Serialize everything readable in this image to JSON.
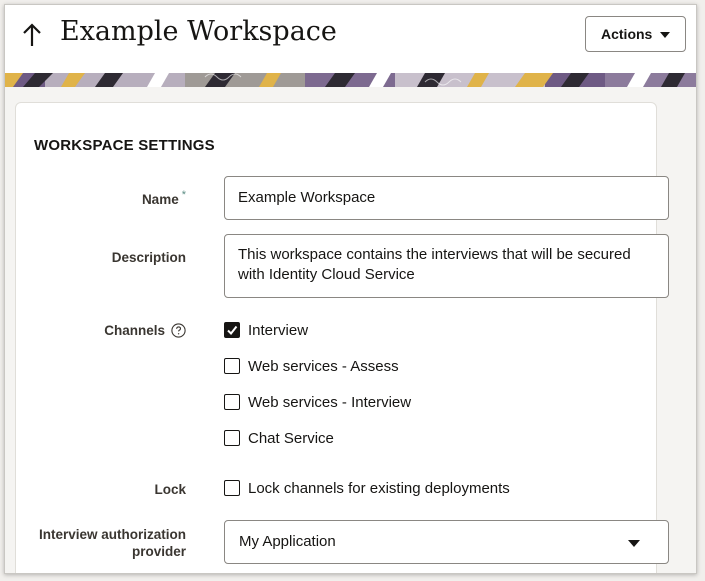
{
  "header": {
    "title": "Example Workspace",
    "actions_label": "Actions"
  },
  "settings": {
    "section_title": "WORKSPACE SETTINGS",
    "name": {
      "label": "Name",
      "required_marker": "*",
      "value": "Example Workspace"
    },
    "description": {
      "label": "Description",
      "value": "This workspace contains the interviews that will be secured with Identity Cloud Service"
    },
    "channels": {
      "label": "Channels",
      "options": [
        {
          "label": "Interview",
          "checked": true
        },
        {
          "label": "Web services - Assess",
          "checked": false
        },
        {
          "label": "Web services - Interview",
          "checked": false
        },
        {
          "label": "Chat Service",
          "checked": false
        }
      ]
    },
    "lock": {
      "label": "Lock",
      "option_label": "Lock channels for existing deployments",
      "checked": false
    },
    "auth_provider": {
      "label": "Interview authorization provider",
      "value": "My Application"
    }
  },
  "colors": {
    "accent_required": "#5b8c83",
    "banner_purple": "#6e5a84",
    "banner_gold": "#e0b349"
  }
}
